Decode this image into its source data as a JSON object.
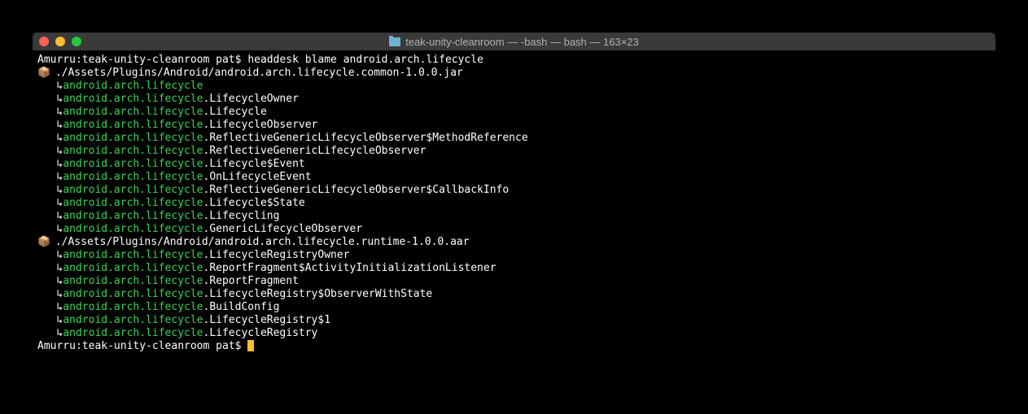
{
  "window": {
    "title": "teak-unity-cleanroom — -bash — bash — 163×23"
  },
  "prompt1": {
    "host": "Amurru",
    "path": "teak-unity-cleanroom",
    "user": "pat",
    "command": "headdesk blame android.arch.lifecycle"
  },
  "jar1": {
    "icon": "📦",
    "path": "./Assets/Plugins/Android/android.arch.lifecycle.common-1.0.0.jar"
  },
  "entries1": [
    {
      "green": "android.arch.lifecycle",
      "white": ""
    },
    {
      "green": "android.arch.lifecycle",
      "white": ".LifecycleOwner"
    },
    {
      "green": "android.arch.lifecycle",
      "white": ".Lifecycle"
    },
    {
      "green": "android.arch.lifecycle",
      "white": ".LifecycleObserver"
    },
    {
      "green": "android.arch.lifecycle",
      "white": ".ReflectiveGenericLifecycleObserver$MethodReference"
    },
    {
      "green": "android.arch.lifecycle",
      "white": ".ReflectiveGenericLifecycleObserver"
    },
    {
      "green": "android.arch.lifecycle",
      "white": ".Lifecycle$Event"
    },
    {
      "green": "android.arch.lifecycle",
      "white": ".OnLifecycleEvent"
    },
    {
      "green": "android.arch.lifecycle",
      "white": ".ReflectiveGenericLifecycleObserver$CallbackInfo"
    },
    {
      "green": "android.arch.lifecycle",
      "white": ".Lifecycle$State"
    },
    {
      "green": "android.arch.lifecycle",
      "white": ".Lifecycling"
    },
    {
      "green": "android.arch.lifecycle",
      "white": ".GenericLifecycleObserver"
    }
  ],
  "jar2": {
    "icon": "📦",
    "path": "./Assets/Plugins/Android/android.arch.lifecycle.runtime-1.0.0.aar"
  },
  "entries2": [
    {
      "green": "android.arch.lifecycle",
      "white": ".LifecycleRegistryOwner"
    },
    {
      "green": "android.arch.lifecycle",
      "white": ".ReportFragment$ActivityInitializationListener"
    },
    {
      "green": "android.arch.lifecycle",
      "white": ".ReportFragment"
    },
    {
      "green": "android.arch.lifecycle",
      "white": ".LifecycleRegistry$ObserverWithState"
    },
    {
      "green": "android.arch.lifecycle",
      "white": ".BuildConfig"
    },
    {
      "green": "android.arch.lifecycle",
      "white": ".LifecycleRegistry$1"
    },
    {
      "green": "android.arch.lifecycle",
      "white": ".LifecycleRegistry"
    }
  ],
  "prompt2": {
    "host": "Amurru",
    "path": "teak-unity-cleanroom",
    "user": "pat"
  },
  "arrow": "↳"
}
